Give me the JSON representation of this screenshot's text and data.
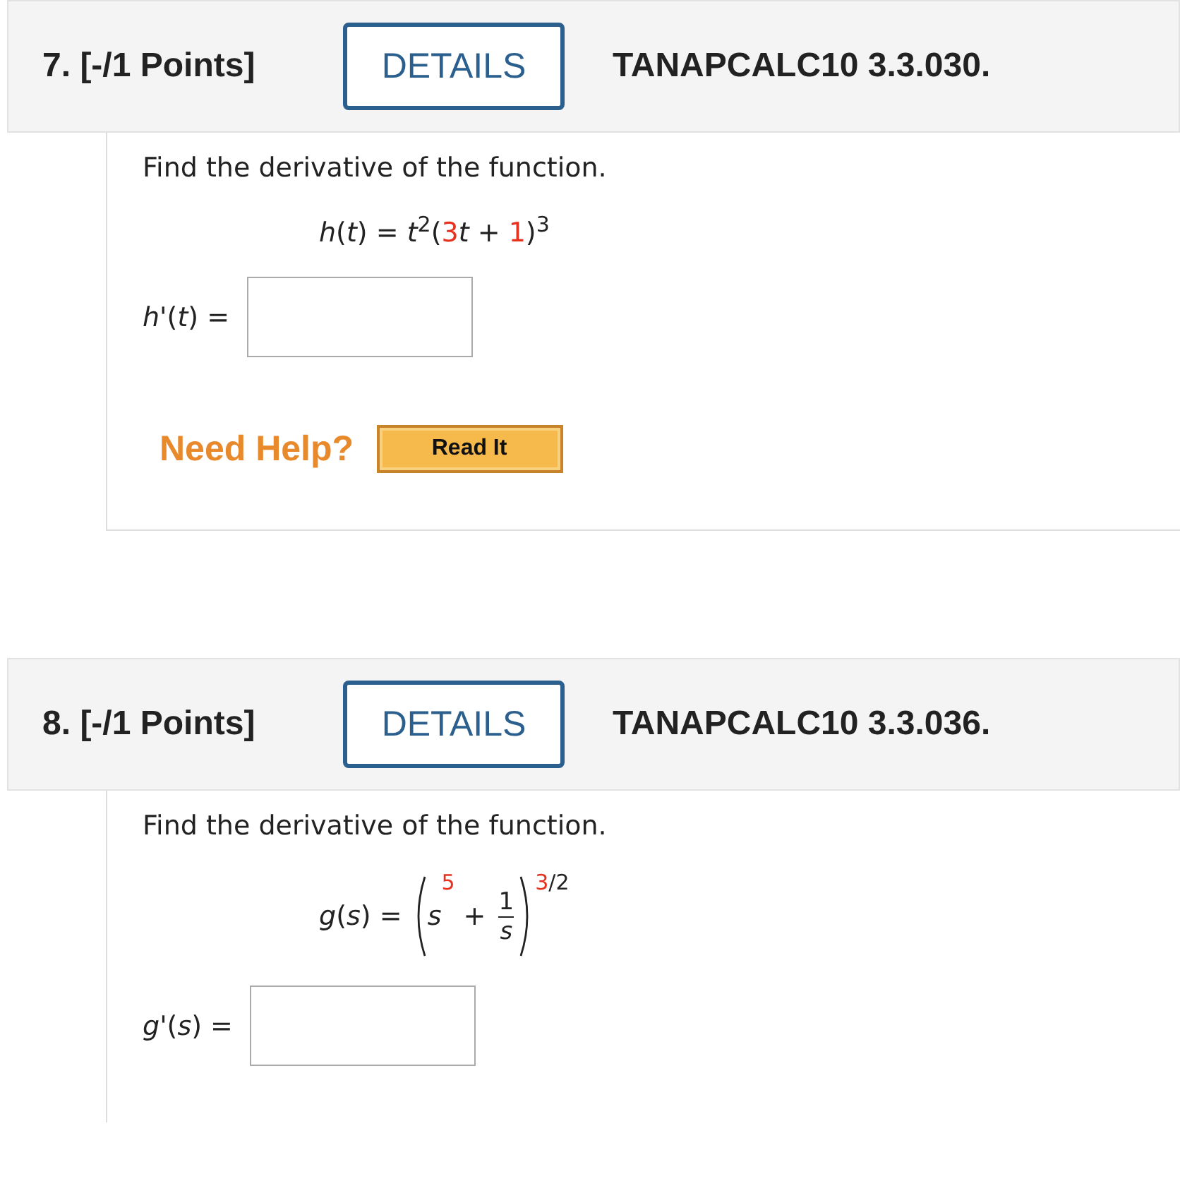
{
  "questions": [
    {
      "number": "7.",
      "points": "[-/1 Points]",
      "details_button": "DETAILS",
      "code": "TANAPCALC10 3.3.030.",
      "prompt": "Find the derivative of the function.",
      "formula": [
        {
          "kind": "text",
          "text": "*h*(*t*) = *t*",
          "highlighted": false
        },
        {
          "kind": "sup",
          "text": "2",
          "highlighted": false
        },
        {
          "kind": "text",
          "text": "(",
          "highlighted": false
        },
        {
          "kind": "text",
          "text": "3",
          "highlighted": true
        },
        {
          "kind": "text",
          "text": "*t* + ",
          "highlighted": false
        },
        {
          "kind": "text",
          "text": "1",
          "highlighted": true
        },
        {
          "kind": "text",
          "text": ")",
          "highlighted": false
        },
        {
          "kind": "sup",
          "text": "3",
          "highlighted": false
        }
      ],
      "answer_label": "*h*'(*t*) =",
      "help": {
        "label": "Need Help?",
        "button": "Read It"
      }
    },
    {
      "number": "8.",
      "points": "[-/1 Points]",
      "details_button": "DETAILS",
      "code": "TANAPCALC10 3.3.036.",
      "prompt": "Find the derivative of the function.",
      "formula": [
        {
          "kind": "text",
          "text": "*g*(*s*) = ",
          "highlighted": false
        },
        {
          "kind": "group",
          "children": [
            {
              "kind": "text",
              "text": "*s*",
              "highlighted": false
            },
            {
              "kind": "sup",
              "text": "5",
              "highlighted": true
            },
            {
              "kind": "text",
              "text": " + ",
              "highlighted": false
            },
            {
              "kind": "frac",
              "numerator": "1",
              "denominator": "*s*",
              "highlighted": false
            }
          ]
        },
        {
          "kind": "sup",
          "text": "3",
          "highlighted": true
        },
        {
          "kind": "sup",
          "text": "/2",
          "highlighted": false
        }
      ],
      "answer_label": "*g*'(*s*) ="
    }
  ]
}
